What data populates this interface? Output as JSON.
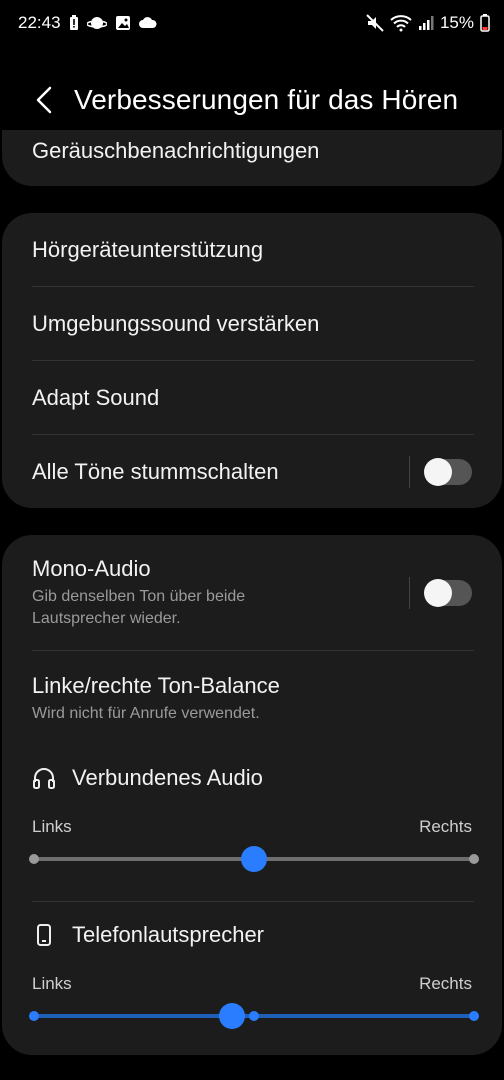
{
  "status_bar": {
    "time": "22:43",
    "battery_percent": "15%",
    "left_icons": [
      "battery-alert-icon",
      "planet-icon",
      "image-icon",
      "cloud-icon"
    ],
    "right_icons": [
      "mute-icon",
      "wifi-icon",
      "signal-icon",
      "battery-icon"
    ]
  },
  "header": {
    "title": "Verbesserungen für das Hören",
    "back_icon": "chevron-left-icon"
  },
  "partial_card": {
    "label": "Geräuschbenachrichtigungen"
  },
  "card1": {
    "items": [
      {
        "label": "Hörgeräteunterstützung"
      },
      {
        "label": "Umgebungssound verstärken"
      },
      {
        "label": "Adapt Sound"
      },
      {
        "label": "Alle Töne stummschalten",
        "toggle": false
      }
    ]
  },
  "card2": {
    "mono": {
      "label": "Mono-Audio",
      "sub": "Gib denselben Ton über beide Lautsprecher wieder.",
      "toggle": false
    },
    "balance": {
      "label": "Linke/rechte Ton-Balance",
      "sub": "Wird nicht für Anrufe verwendet."
    },
    "sliders": [
      {
        "title": "Verbundenes Audio",
        "icon": "headphones-icon",
        "left_label": "Links",
        "right_label": "Rechts",
        "value": 0.5,
        "active": false
      },
      {
        "title": "Telefonlautsprecher",
        "icon": "phone-icon",
        "left_label": "Links",
        "right_label": "Rechts",
        "value": 0.45,
        "active": true
      }
    ]
  },
  "colors": {
    "accent": "#2a7dff",
    "track_active": "#1f5fb8",
    "track_inactive": "#6e6e6e",
    "card_bg": "#1c1c1c",
    "page_bg": "#000000"
  }
}
